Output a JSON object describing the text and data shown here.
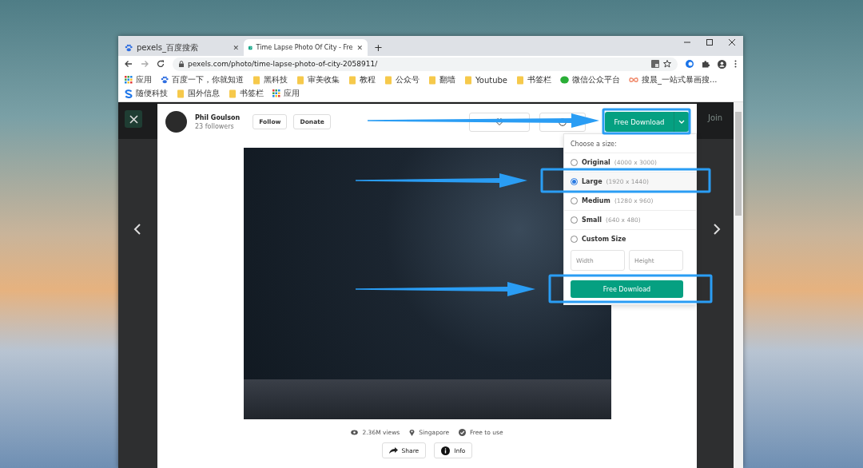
{
  "browser": {
    "tabs": [
      {
        "title": "pexels_百度搜索",
        "close": "✕",
        "selected": false
      },
      {
        "title": "Time Lapse Photo Of City - Fre",
        "close": "✕",
        "selected": true
      }
    ],
    "new_tab": "+",
    "address": "pexels.com/photo/time-lapse-photo-of-city-2058911/",
    "bookmarks": [
      {
        "label": "应用",
        "kind": "apps"
      },
      {
        "label": "百度一下，你就知道",
        "kind": "paw"
      },
      {
        "label": "黑科技",
        "kind": "folder"
      },
      {
        "label": "审美收集",
        "kind": "folder"
      },
      {
        "label": "教程",
        "kind": "folder"
      },
      {
        "label": "公众号",
        "kind": "folder"
      },
      {
        "label": "翻墙",
        "kind": "folder"
      },
      {
        "label": "Youtube",
        "kind": "folder"
      },
      {
        "label": "书签栏",
        "kind": "folder"
      },
      {
        "label": "微信公众平台",
        "kind": "wechat"
      },
      {
        "label": "搜晨_一站式暴画搜...",
        "kind": "loop"
      },
      {
        "label": "随便科技",
        "kind": "s"
      },
      {
        "label": "国外信息",
        "kind": "folder"
      },
      {
        "label": "书签栏",
        "kind": "folder"
      },
      {
        "label": "应用",
        "kind": "apps"
      }
    ]
  },
  "backdrop": {
    "join": "Join"
  },
  "modal": {
    "photographer": {
      "name": "Phil Goulson",
      "followers": "23 followers"
    },
    "follow": "Follow",
    "donate": "Donate",
    "download": "Free Download",
    "dropdown": {
      "heading": "Choose a size:",
      "options": [
        {
          "name": "Original",
          "size": "(4000 x 3000)",
          "selected": false
        },
        {
          "name": "Large",
          "size": "(1920 x 1440)",
          "selected": true
        },
        {
          "name": "Medium",
          "size": "(1280 x 960)",
          "selected": false
        },
        {
          "name": "Small",
          "size": "(640 x 480)",
          "selected": false
        },
        {
          "name": "Custom Size",
          "selected": false
        }
      ],
      "width_placeholder": "Width",
      "height_placeholder": "Height",
      "button": "Free Download"
    },
    "stats": [
      {
        "kind": "views",
        "text": "2.36M views"
      },
      {
        "kind": "location",
        "text": "Singapore"
      },
      {
        "kind": "license",
        "text": "Free to use"
      }
    ],
    "actions": [
      {
        "kind": "share",
        "label": "Share"
      },
      {
        "kind": "info",
        "label": "Info"
      }
    ]
  }
}
